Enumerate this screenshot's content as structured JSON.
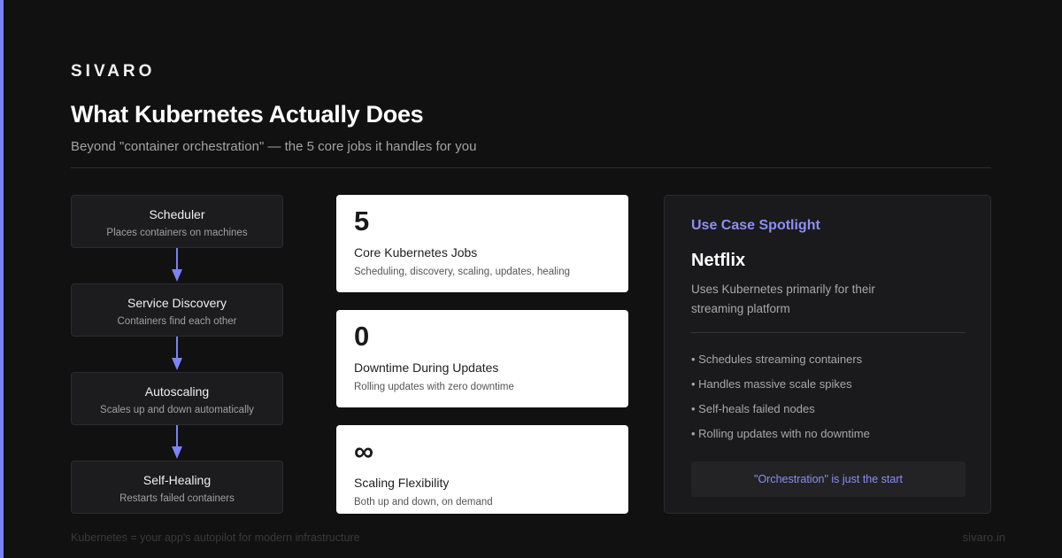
{
  "brand": "SIVARO",
  "title": "What Kubernetes Actually Does",
  "subtitle": "Beyond \"container orchestration\" — the 5 core jobs it handles for you",
  "accent_color": "#7c83f5",
  "flow": [
    {
      "name": "Scheduler",
      "desc": "Places containers on machines"
    },
    {
      "name": "Service Discovery",
      "desc": "Containers find each other"
    },
    {
      "name": "Autoscaling",
      "desc": "Scales up and down automatically"
    },
    {
      "name": "Self-Healing",
      "desc": "Restarts failed containers"
    }
  ],
  "stats": [
    {
      "value": "5",
      "label": "Core Kubernetes Jobs",
      "sub": "Scheduling, discovery, scaling, updates, healing"
    },
    {
      "value": "0",
      "label": "Downtime During Updates",
      "sub": "Rolling updates with zero downtime"
    },
    {
      "value": "∞",
      "label": "Scaling Flexibility",
      "sub": "Both up and down, on demand"
    }
  ],
  "spotlight": {
    "heading": "Use Case Spotlight",
    "company": "Netflix",
    "desc": "Uses Kubernetes primarily for their streaming platform",
    "items": [
      "• Schedules streaming containers",
      "• Handles massive scale spikes",
      "• Self-heals failed nodes",
      "• Rolling updates with no downtime"
    ],
    "callout": "\"Orchestration\" is just the start"
  },
  "footer": {
    "tagline": "Kubernetes = your app's autopilot for modern infrastructure",
    "site": "sivaro.in"
  }
}
